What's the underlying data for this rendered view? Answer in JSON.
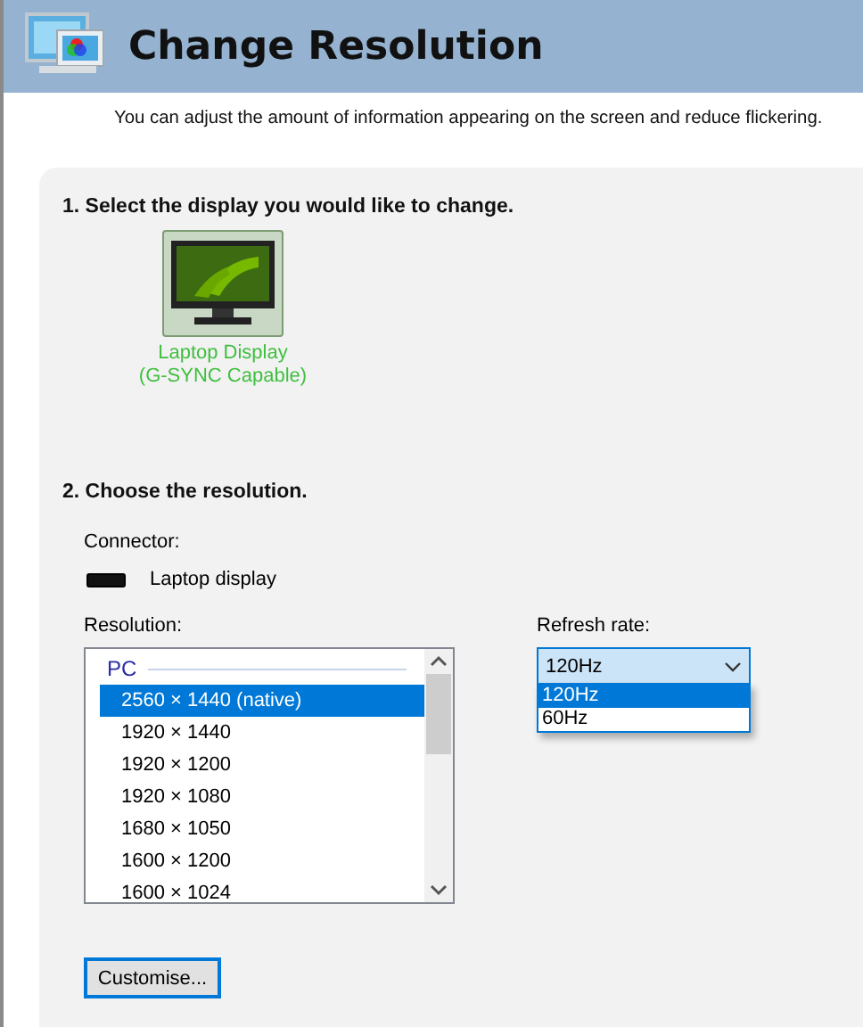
{
  "header": {
    "title": "Change Resolution",
    "description": "You can adjust the amount of information appearing on the screen and reduce flickering."
  },
  "display_section": {
    "heading": "1. Select the display you would like to change.",
    "displays": [
      {
        "label": "Laptop Display",
        "sublabel": "(G-SYNC Capable)",
        "selected": true
      }
    ]
  },
  "resolution_section": {
    "heading": "2. Choose the resolution.",
    "connector_label": "Connector:",
    "connector": "Laptop display",
    "resolution_label": "Resolution:",
    "resolution_list": {
      "group": "PC",
      "items": [
        {
          "label": "2560 × 1440 (native)",
          "selected": true
        },
        {
          "label": "1920 × 1440",
          "selected": false
        },
        {
          "label": "1920 × 1200",
          "selected": false
        },
        {
          "label": "1920 × 1080",
          "selected": false
        },
        {
          "label": "1680 × 1050",
          "selected": false
        },
        {
          "label": "1600 × 1200",
          "selected": false
        },
        {
          "label": "1600 × 1024",
          "selected": false
        }
      ]
    },
    "refresh_label": "Refresh rate:",
    "refresh_dropdown": {
      "value": "120Hz",
      "expanded": true,
      "options": [
        {
          "label": "120Hz",
          "selected": true
        },
        {
          "label": "60Hz",
          "selected": false
        }
      ]
    },
    "customise_button": "Customise..."
  }
}
